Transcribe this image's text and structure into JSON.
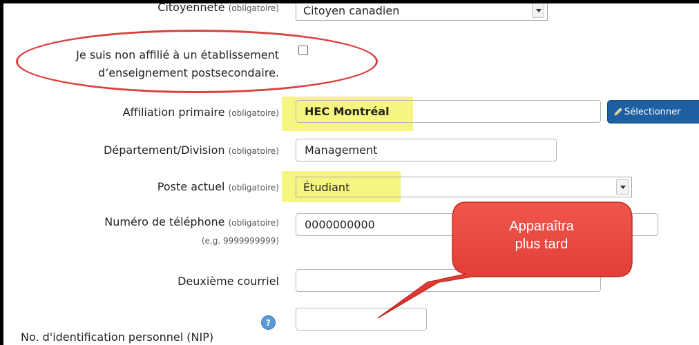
{
  "citizenship": {
    "label": "Citoyenneté",
    "required": "(obligatoire)",
    "value": "Citoyen canadien"
  },
  "non_affiliated": {
    "label_line1": "Je suis non affilié à un établissement",
    "label_line2": "d’enseignement postsecondaire."
  },
  "primary_affiliation": {
    "label": "Affiliation primaire",
    "required": "(obligatoire)",
    "value": "HEC Montréal",
    "select_button": "Sélectionner"
  },
  "department": {
    "label": "Département/Division",
    "required": "(obligatoire)",
    "value": "Management"
  },
  "position": {
    "label": "Poste actuel",
    "required": "(obligatoire)",
    "value": "Étudiant"
  },
  "phone": {
    "label": "Numéro de téléphone",
    "required": "(obligatoire)",
    "hint": "(e.g. 9999999999)",
    "value": "0000000000"
  },
  "second_email": {
    "label": "Deuxième courriel",
    "value": ""
  },
  "pin": {
    "label": "No. d'identification personnel (NIP)",
    "value": "",
    "help_icon": "?"
  },
  "callout": {
    "line1": "Apparaîtra",
    "line2": "plus tard"
  },
  "colors": {
    "highlight": "#f5f580",
    "annotation_red": "#d9413d",
    "button_blue": "#1d5fa0"
  }
}
